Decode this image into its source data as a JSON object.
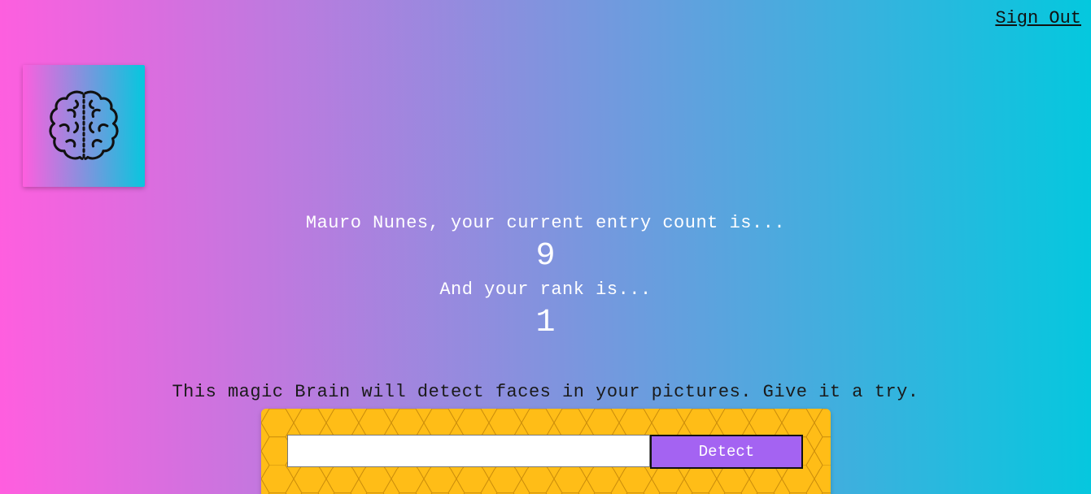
{
  "nav": {
    "signout_label": "Sign Out"
  },
  "logo": {
    "icon": "brain-icon"
  },
  "rank": {
    "intro_text": "Mauro Nunes, your current entry count is...",
    "entry_count": "9",
    "rank_text": "And your rank is...",
    "rank_value": "1"
  },
  "description": {
    "text": "This magic Brain will detect faces in your pictures. Give it a try."
  },
  "form": {
    "input_value": "",
    "input_placeholder": "",
    "detect_label": "Detect"
  },
  "colors": {
    "gradient_start": "#ff5edf",
    "gradient_end": "#04c8de",
    "panel": "#ffbd17",
    "button": "#a463f2"
  }
}
